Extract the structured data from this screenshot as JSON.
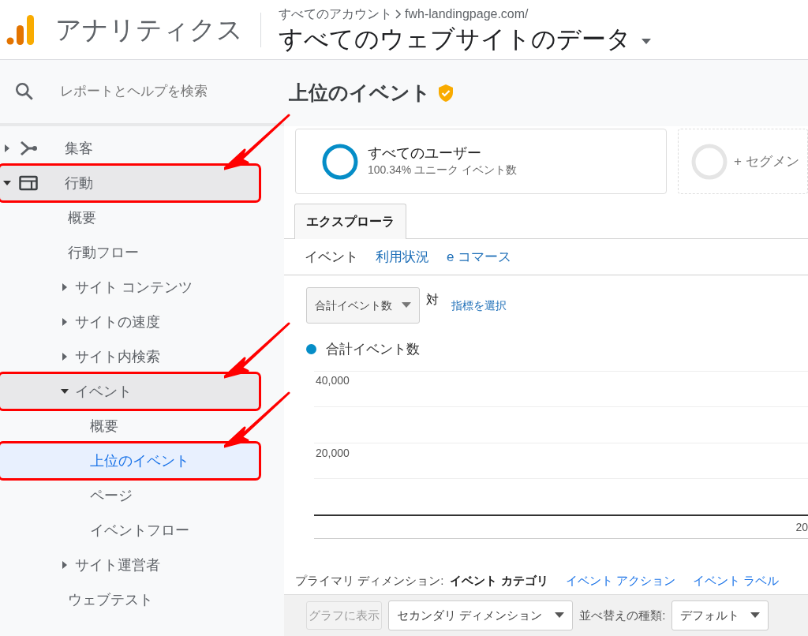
{
  "header": {
    "app_name": "アナリティクス",
    "breadcrumb": [
      "すべてのアカウント",
      "fwh-landingpage.com/"
    ],
    "view_name": "すべてのウェブサイトのデータ"
  },
  "sidebar": {
    "search": {
      "placeholder": "レポートとヘルプを検索"
    },
    "items": [
      {
        "label": "集客",
        "kind": "section",
        "expanded": false,
        "active": false,
        "selected": false,
        "highlighted": false
      },
      {
        "label": "行動",
        "kind": "section",
        "expanded": true,
        "active": true,
        "selected": false,
        "highlighted": true,
        "children": [
          {
            "label": "概要",
            "kind": "leaf",
            "active": false,
            "selected": false,
            "highlighted": false
          },
          {
            "label": "行動フロー",
            "kind": "leaf",
            "active": false,
            "selected": false,
            "highlighted": false
          },
          {
            "label": "サイト コンテンツ",
            "kind": "group",
            "expanded": false,
            "active": false,
            "selected": false,
            "highlighted": false
          },
          {
            "label": "サイトの速度",
            "kind": "group",
            "expanded": false,
            "active": false,
            "selected": false,
            "highlighted": false
          },
          {
            "label": "サイト内検索",
            "kind": "group",
            "expanded": false,
            "active": false,
            "selected": false,
            "highlighted": false
          },
          {
            "label": "イベント",
            "kind": "group",
            "expanded": true,
            "active": true,
            "selected": false,
            "highlighted": true,
            "children": [
              {
                "label": "概要",
                "kind": "leaf",
                "active": false,
                "selected": false,
                "highlighted": false
              },
              {
                "label": "上位のイベント",
                "kind": "leaf",
                "active": false,
                "selected": true,
                "highlighted": true
              },
              {
                "label": "ページ",
                "kind": "leaf",
                "active": false,
                "selected": false,
                "highlighted": false
              },
              {
                "label": "イベントフロー",
                "kind": "leaf",
                "active": false,
                "selected": false,
                "highlighted": false
              }
            ]
          },
          {
            "label": "サイト運営者",
            "kind": "group",
            "expanded": false,
            "active": false,
            "selected": false,
            "highlighted": false
          },
          {
            "label": "ウェブテスト",
            "kind": "leaf",
            "active": false,
            "selected": false,
            "highlighted": false
          }
        ]
      }
    ]
  },
  "main": {
    "title": "上位のイベント",
    "verified": true,
    "segments": [
      {
        "name": "すべてのユーザー",
        "detail": "100.34% ユニーク イベント数",
        "kind": "active"
      },
      {
        "name": "+ セグメン",
        "kind": "add"
      }
    ],
    "tabs": [
      {
        "label": "エクスプローラ",
        "selected": true
      }
    ],
    "subtabs": [
      {
        "label": "イベント",
        "selected": true
      },
      {
        "label": "利用状況",
        "selected": false
      },
      {
        "label": "e コマース",
        "selected": false
      }
    ],
    "metric_select": {
      "value": "合計イベント数",
      "vs": "対",
      "link": "指標を選択"
    },
    "legend": {
      "label": "合計イベント数",
      "color": "#058dc7"
    },
    "chart": {
      "y_labels": [
        "40,000",
        "20,000"
      ],
      "x_label": "20"
    },
    "primary_dimension": {
      "label": "プライマリ ディメンション:",
      "options": [
        {
          "label": "イベント カテゴリ",
          "selected": true
        },
        {
          "label": "イベント アクション",
          "selected": false
        },
        {
          "label": "イベント ラベル",
          "selected": false
        }
      ]
    },
    "toolbar": {
      "plot_button": {
        "label": "グラフに表示",
        "disabled": true
      },
      "secondary_dimension": "セカンダリ ディメンション",
      "sort_label": "並べ替えの種類:",
      "sort_value": "デフォルト"
    }
  }
}
